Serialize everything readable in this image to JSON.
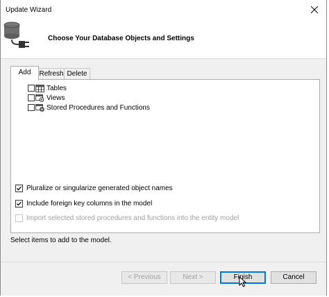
{
  "window": {
    "title": "Update Wizard"
  },
  "header": {
    "heading": "Choose Your Database Objects and Settings"
  },
  "tabs": [
    {
      "label": "Add",
      "active": true
    },
    {
      "label": "Refresh",
      "active": false
    },
    {
      "label": "Delete",
      "active": false
    }
  ],
  "tree": [
    {
      "label": "Tables",
      "checked": false,
      "icon": "table-icon"
    },
    {
      "label": "Views",
      "checked": false,
      "icon": "view-icon"
    },
    {
      "label": "Stored Procedures and Functions",
      "checked": false,
      "icon": "stored-procedure-icon"
    }
  ],
  "options": {
    "pluralize": {
      "label": "Pluralize or singularize generated object names",
      "checked": true,
      "enabled": true
    },
    "foreign_keys": {
      "label": "Include foreign key columns in the model",
      "checked": true,
      "enabled": true
    },
    "import_sprocs": {
      "label": "Import selected stored procedures and functions into the entity model",
      "checked": false,
      "enabled": false
    }
  },
  "status_text": "Select items to add to the model.",
  "buttons": {
    "previous": "< Previous",
    "next": "Next >",
    "finish": "Finish",
    "cancel": "Cancel"
  },
  "colors": {
    "accent": "#0078d7",
    "dialog_bg": "#f0f0f0"
  }
}
